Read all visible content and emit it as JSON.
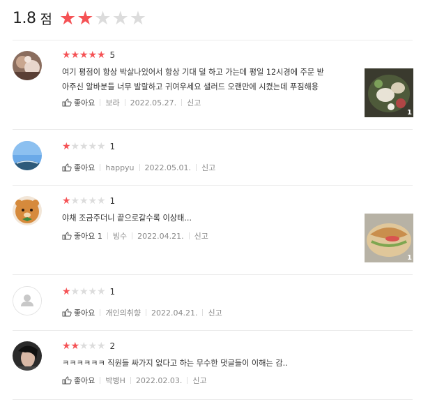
{
  "summary": {
    "score": "1.8",
    "unit": "점",
    "stars_filled": 2,
    "stars_total": 5
  },
  "colors": {
    "star_on": "#f55255",
    "star_off": "#dcdcdc",
    "divider": "#ebebeb"
  },
  "like_label": "좋아요",
  "report_label": "신고",
  "reviews": [
    {
      "rating": 5,
      "rating_text": "5",
      "text": [
        "여기 평점이 항상 박살나있어서 항상 기대 덜 하고 가는데 평일 12시경에 주문 받",
        "아주신 알바분들 너무 발랄하고 귀여우세요 샐러드 오랜만에 시켰는데 푸짐해용"
      ],
      "like_text": "좋아요",
      "author": "보라",
      "date": "2022.05.27.",
      "report": "신고",
      "avatar": "food-photo-avatar",
      "photo_count": "1"
    },
    {
      "rating": 1,
      "rating_text": "1",
      "text": [],
      "like_text": "좋아요",
      "author": "happyu",
      "date": "2022.05.01.",
      "report": "신고",
      "avatar": "sky-photo-avatar"
    },
    {
      "rating": 1,
      "rating_text": "1",
      "text": [
        "야채 조금주더니 끝으로갈수록 이상태..."
      ],
      "like_text": "좋아요 1",
      "author": "빙수",
      "date": "2022.04.21.",
      "report": "신고",
      "avatar": "character-avatar",
      "photo_count": "1"
    },
    {
      "rating": 1,
      "rating_text": "1",
      "text": [],
      "like_text": "좋아요",
      "author": "개인의취향",
      "date": "2022.04.21.",
      "report": "신고",
      "avatar": "default-user-avatar"
    },
    {
      "rating": 2,
      "rating_text": "2",
      "text": [
        "ㅋㅋㅋㅋㅋㅋ 직원들 싸가지 없다고 하는 무수한 댓글들이 이해는 감.."
      ],
      "like_text": "좋아요",
      "author": "박병H",
      "date": "2022.02.03.",
      "report": "신고",
      "avatar": "person-photo-avatar"
    }
  ]
}
